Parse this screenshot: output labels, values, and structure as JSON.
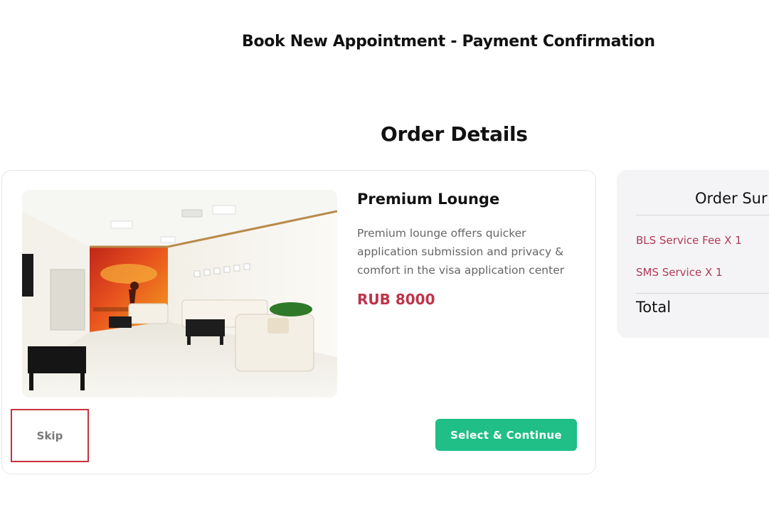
{
  "header": {
    "title": "Book New Appointment - Payment Confirmation"
  },
  "order_details": {
    "title": "Order Details"
  },
  "product": {
    "name": "Premium Lounge",
    "description": "Premium lounge offers quicker application submission and privacy & comfort in the visa application center",
    "price": "RUB 8000",
    "image": "lounge-photo",
    "skip_label": "Skip",
    "select_label": "Select & Continue"
  },
  "summary": {
    "title": "Order Sur",
    "items": [
      {
        "label": "BLS Service Fee X 1"
      },
      {
        "label": "SMS Service X 1"
      }
    ],
    "total_label": "Total"
  },
  "colors": {
    "accent_green": "#1fbf87",
    "price_red": "#c0334a",
    "summary_item_red": "#b23a56",
    "highlight_border": "#c8323a"
  }
}
